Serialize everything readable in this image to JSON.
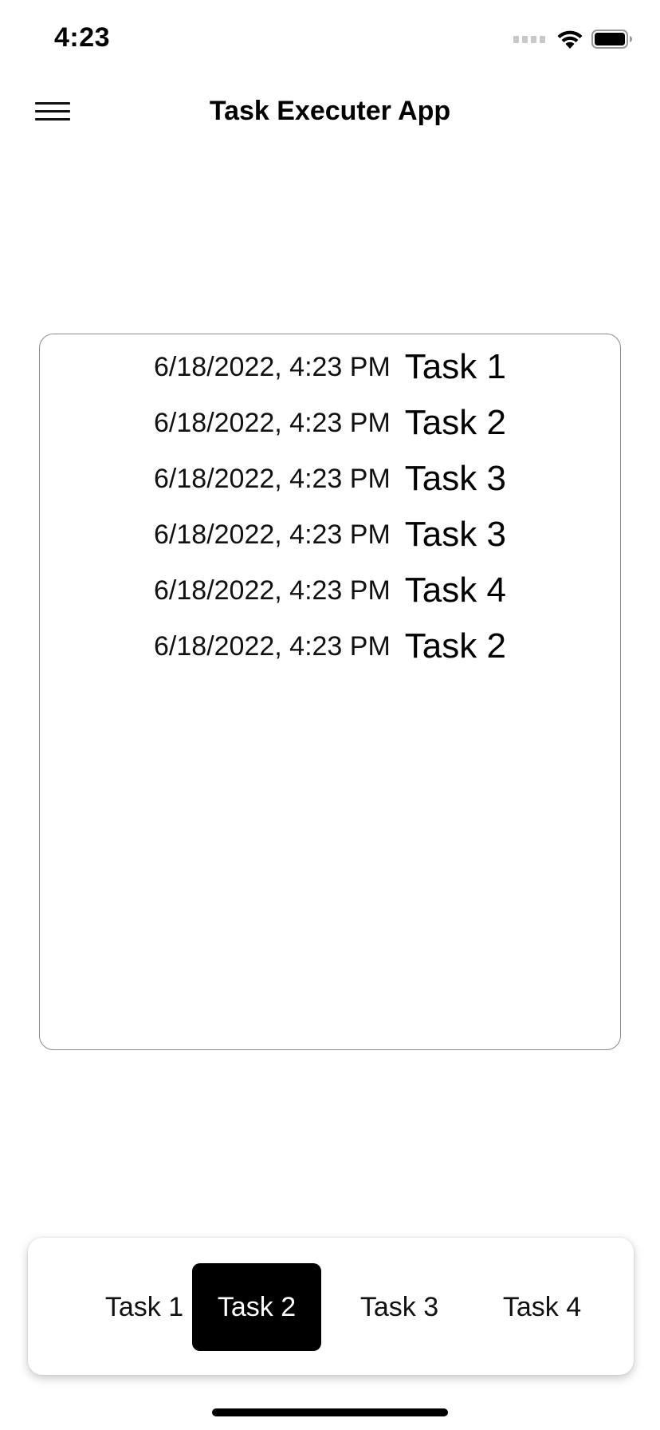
{
  "status_bar": {
    "time": "4:23",
    "icons": [
      "signal-dots-icon",
      "wifi-icon",
      "battery-icon"
    ]
  },
  "nav": {
    "menu_icon": "hamburger-menu-icon",
    "title": "Task Executer App"
  },
  "task_log": {
    "rows": [
      {
        "time": "6/18/2022, 4:23 PM",
        "task": "Task 1"
      },
      {
        "time": "6/18/2022, 4:23 PM",
        "task": "Task 2"
      },
      {
        "time": "6/18/2022, 4:23 PM",
        "task": "Task 3"
      },
      {
        "time": "6/18/2022, 4:23 PM",
        "task": "Task 3"
      },
      {
        "time": "6/18/2022, 4:23 PM",
        "task": "Task 4"
      },
      {
        "time": "6/18/2022, 4:23 PM",
        "task": "Task 2"
      }
    ]
  },
  "tabs": {
    "items": [
      {
        "label": "Task 1",
        "selected": false
      },
      {
        "label": "Task 2",
        "selected": true
      },
      {
        "label": "Task 3",
        "selected": false
      },
      {
        "label": "Task 4",
        "selected": false
      }
    ]
  },
  "colors": {
    "selected_tab_bg": "#000000",
    "selected_tab_text": "#ffffff",
    "border": "#8a8a8a"
  }
}
